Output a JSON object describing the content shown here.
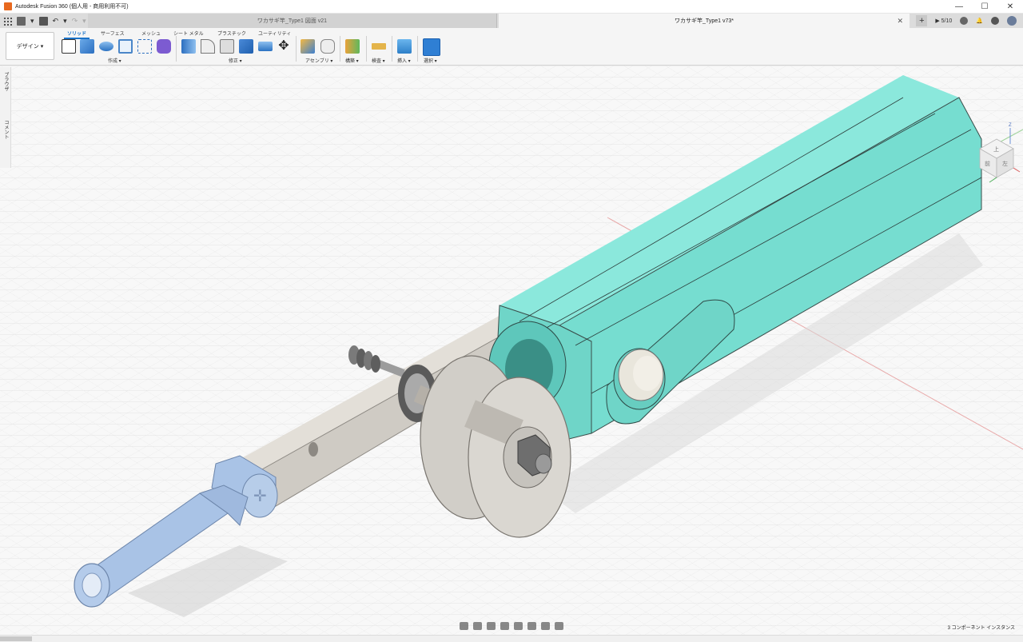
{
  "window": {
    "title": "Autodesk Fusion 360 (個人用 - 商用利用不可)",
    "controls": [
      "—",
      "☐",
      "✕"
    ]
  },
  "tabs": [
    {
      "label": "ワカサギ竿_Type1 図面 v21",
      "active": false
    },
    {
      "label": "ワカサギ竿_Type1 v73*",
      "active": true
    }
  ],
  "tabbar_right": {
    "job_count": "5/10"
  },
  "toolbar": {
    "workspace": "デザイン ▾",
    "tabs": [
      "ソリッド",
      "サーフェス",
      "メッシュ",
      "シート メタル",
      "プラスチック",
      "ユーティリティ"
    ],
    "groups": {
      "create": "作成 ▾",
      "modify": "修正 ▾",
      "assemble": "アセンブリ ▾",
      "construct": "構築 ▾",
      "inspect": "検査 ▾",
      "insert": "挿入 ▾",
      "select": "選択 ▾"
    }
  },
  "browser_panel": {
    "items": [
      "ブラウザ",
      "コメント"
    ]
  },
  "viewcube": {
    "faces": [
      "上",
      "前",
      "左"
    ],
    "axis": "Z"
  },
  "status": {
    "instance_info": "3 コンポーネント インスタンス"
  },
  "colors": {
    "body_main": "#76ddd0",
    "body_plate": "#cfcbc4",
    "handle_blue": "#a9c3e6",
    "toolbar_bg": "#f5f5f5",
    "accent": "#1a73c9"
  }
}
